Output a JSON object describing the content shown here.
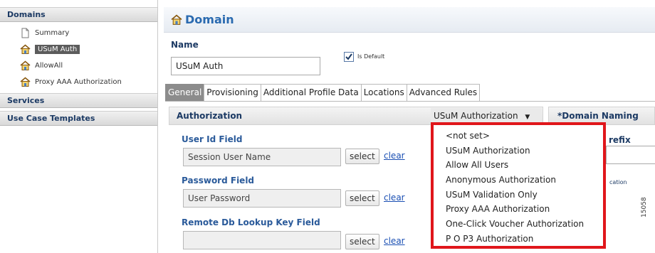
{
  "sidebar": {
    "domains_header": "Domains",
    "items": [
      {
        "label": "Summary",
        "icon": "page-icon"
      },
      {
        "label": "USuM Auth",
        "icon": "house-icon",
        "selected": true
      },
      {
        "label": "AllowAll",
        "icon": "house-icon"
      },
      {
        "label": "Proxy AAA Authorization",
        "icon": "house-icon"
      }
    ],
    "services_header": "Services",
    "templates_header": "Use Case Templates"
  },
  "header": {
    "title": "Domain",
    "icon": "house-icon"
  },
  "name_field": {
    "label": "Name",
    "value": "USuM Auth"
  },
  "is_default": {
    "label": "Is Default",
    "checked": true
  },
  "tabs": [
    {
      "label": "General",
      "active": true
    },
    {
      "label": "Provisioning"
    },
    {
      "label": "Additional Profile Data"
    },
    {
      "label": "Locations"
    },
    {
      "label": "Advanced Rules"
    }
  ],
  "authorization": {
    "section_title": "Authorization",
    "selected": "USuM Authorization",
    "options": [
      "<not set>",
      "USuM Authorization",
      "Allow All Users",
      "Anonymous Authorization",
      "USuM Validation Only",
      "Proxy AAA Authorization",
      "One-Click Voucher Authorization",
      "P O P3 Authorization"
    ]
  },
  "fields": [
    {
      "label": "User Id Field",
      "value": "Session User Name"
    },
    {
      "label": "Password Field",
      "value": "User Password"
    },
    {
      "label": "Remote Db Lookup Key Field",
      "value": ""
    }
  ],
  "buttons": {
    "select": "select",
    "clear": "clear"
  },
  "domain_naming": {
    "title": "*Domain Naming",
    "partial_label": "refix",
    "partial_small": "cation"
  },
  "figure_id": "15058",
  "colors": {
    "highlight_border": "#e0161b",
    "link": "#1a4fb3",
    "title": "#2a6ab0"
  }
}
